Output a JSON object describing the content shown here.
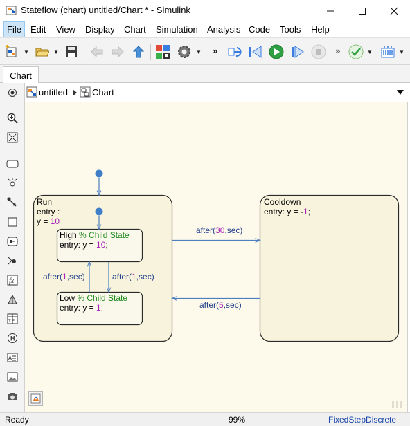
{
  "window": {
    "title": "Stateflow (chart) untitled/Chart * - Simulink",
    "minimize": "—",
    "maximize": "☐",
    "close": "✕"
  },
  "menu": {
    "items": [
      "File",
      "Edit",
      "View",
      "Display",
      "Chart",
      "Simulation",
      "Analysis",
      "Code",
      "Tools",
      "Help"
    ]
  },
  "toolbar": {
    "icons": [
      "new-model-icon",
      "open-folder-icon",
      "save-icon",
      "back-icon",
      "forward-icon",
      "up-to-parent-icon",
      "library-browser-icon",
      "model-settings-icon",
      "step-back-icon",
      "run-icon",
      "step-forward-icon",
      "stop-icon",
      "model-advisor-icon",
      "build-icon"
    ],
    "more": "»"
  },
  "tabs": [
    "Chart"
  ],
  "breadcrumb": {
    "model": "untitled",
    "chart": "Chart"
  },
  "chart": {
    "states": {
      "run": {
        "name": "Run",
        "entry": "entry :",
        "assign_var": "y = ",
        "assign_val": "10"
      },
      "high": {
        "name": "High",
        "comment": "% Child State",
        "entry_prefix": "entry: y = ",
        "entry_val": "10",
        "entry_suffix": ";"
      },
      "low": {
        "name": "Low",
        "comment": "% Child State",
        "entry_prefix": "entry: y = ",
        "entry_val": "1",
        "entry_suffix": ";"
      },
      "cooldown": {
        "name": "Cooldown",
        "entry_prefix": "entry: y = -",
        "entry_val": "1",
        "entry_suffix": ";"
      }
    },
    "transitions": {
      "run_to_cooldown": {
        "pre": "after(",
        "num": "30",
        "post": ",sec)"
      },
      "cooldown_to_run": {
        "pre": "after(",
        "num": "5",
        "post": ",sec)"
      },
      "low_to_high": {
        "pre": "after(",
        "num": "1",
        "post": ",sec)"
      },
      "high_to_low": {
        "pre": "after(",
        "num": "1",
        "post": ",sec)"
      }
    },
    "colors": {
      "state_border": "#2b2b2b",
      "state_fill": "#f7f3dc",
      "transition": "#4d7fbe",
      "keyword": "#23408c",
      "number": "#a820b8",
      "comment": "#1f8a1f",
      "canvas_bg": "#fdfaeb"
    }
  },
  "palette": {
    "tools": [
      "hide-palette-icon",
      "zoom-icon",
      "fit-view-icon",
      "state-tool-icon",
      "history-junction-icon",
      "default-transition-icon",
      "box-tool-icon",
      "simulink-state-icon",
      "connective-junction-icon",
      "matlab-function-icon",
      "truth-table-icon",
      "graphical-function-icon",
      "history-icon",
      "annotation-icon",
      "image-icon",
      "camera-icon",
      "explorer-bar-icon"
    ]
  },
  "status": {
    "left": "Ready",
    "zoom": "99%",
    "solver": "FixedStepDiscrete"
  }
}
